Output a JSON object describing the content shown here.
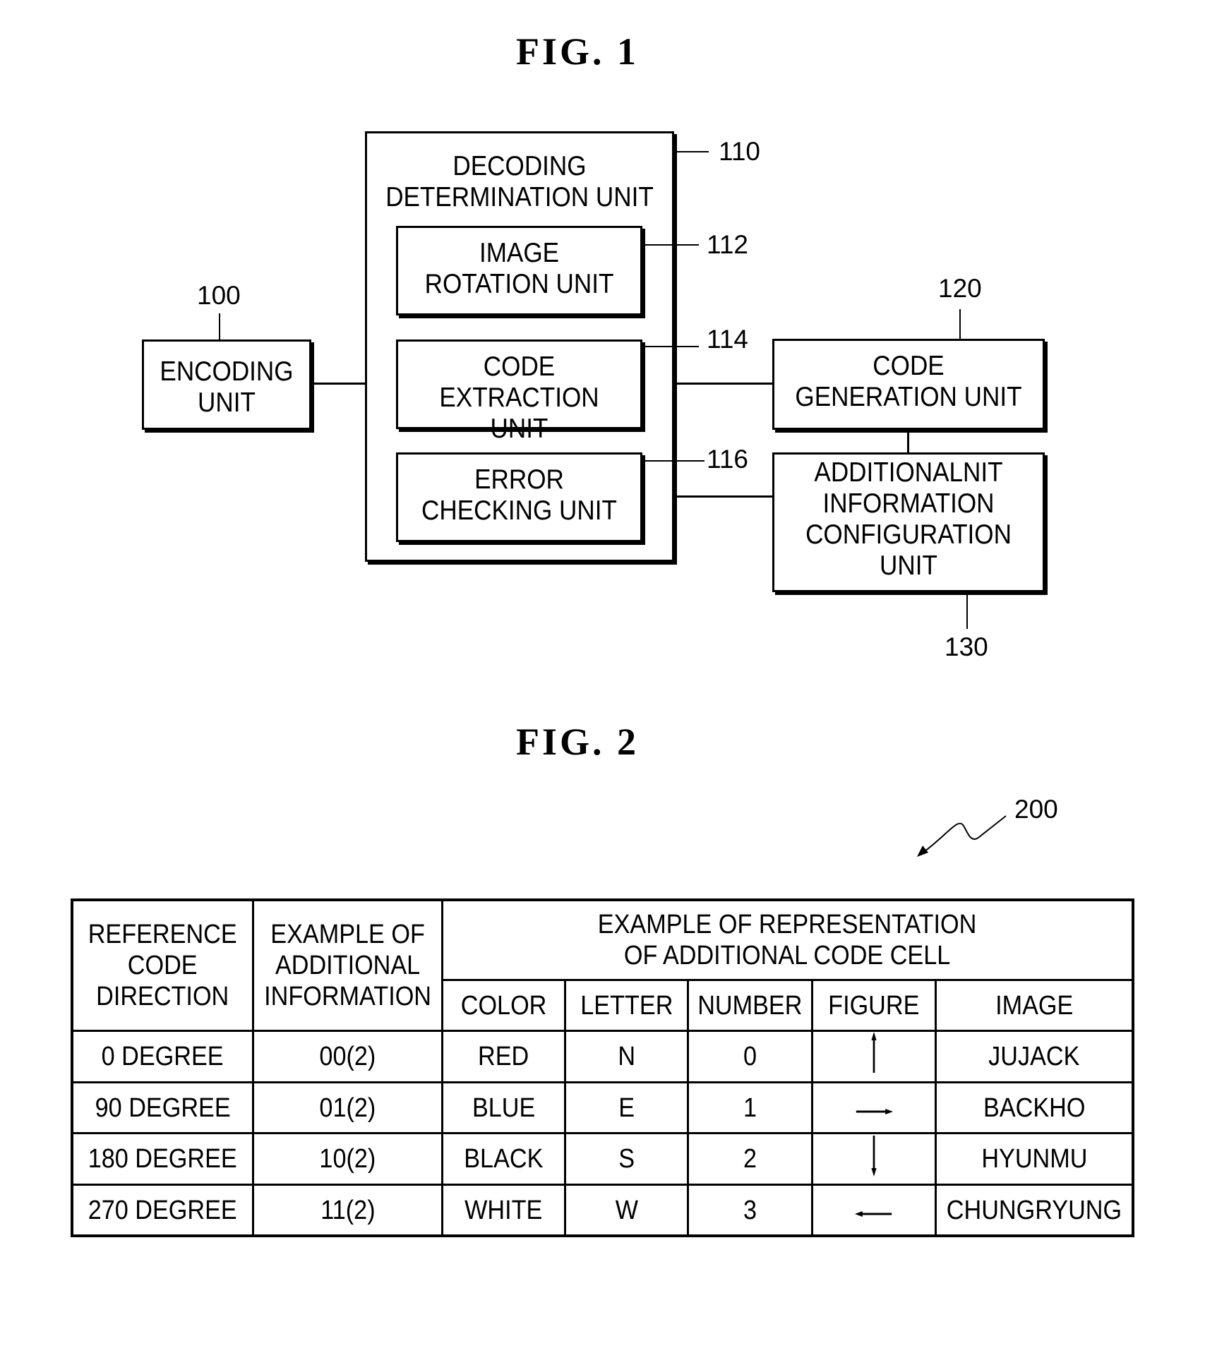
{
  "fig1": {
    "title": "FIG.  1",
    "blocks": {
      "encoding": {
        "label": "ENCODING\nUNIT",
        "ref": "100"
      },
      "decoding": {
        "label": "DECODING\nDETERMINATION UNIT",
        "ref": "110"
      },
      "rotation": {
        "label": "IMAGE\nROTATION UNIT",
        "ref": "112"
      },
      "extraction": {
        "label": "CODE\nEXTRACTION UNIT",
        "ref": "114"
      },
      "error": {
        "label": "ERROR\nCHECKING UNIT",
        "ref": "116"
      },
      "generation": {
        "label": "CODE\nGENERATION UNIT",
        "ref": "120"
      },
      "additional": {
        "label": "ADDITIONALNIT\nINFORMATION\nCONFIGURATION\nUNIT",
        "ref": "130"
      }
    }
  },
  "fig2": {
    "title": "FIG.  2",
    "ref": "200",
    "headers": {
      "direction": "REFERENCE\nCODE\nDIRECTION",
      "additional": "EXAMPLE OF\nADDITIONAL\nINFORMATION",
      "representation": "EXAMPLE OF REPRESENTATION\nOF ADDITIONAL CODE CELL",
      "sub": [
        "COLOR",
        "LETTER",
        "NUMBER",
        "FIGURE",
        "IMAGE"
      ]
    },
    "rows": [
      {
        "direction": "0 DEGREE",
        "info": "00(2)",
        "color": "RED",
        "letter": "N",
        "number": "0",
        "figure": "arrow-up",
        "image": "JUJACK"
      },
      {
        "direction": "90 DEGREE",
        "info": "01(2)",
        "color": "BLUE",
        "letter": "E",
        "number": "1",
        "figure": "arrow-right",
        "image": "BACKHO"
      },
      {
        "direction": "180 DEGREE",
        "info": "10(2)",
        "color": "BLACK",
        "letter": "S",
        "number": "2",
        "figure": "arrow-down",
        "image": "HYUNMU"
      },
      {
        "direction": "270 DEGREE",
        "info": "11(2)",
        "color": "WHITE",
        "letter": "W",
        "number": "3",
        "figure": "arrow-left",
        "image": "CHUNGRYUNG"
      }
    ]
  }
}
